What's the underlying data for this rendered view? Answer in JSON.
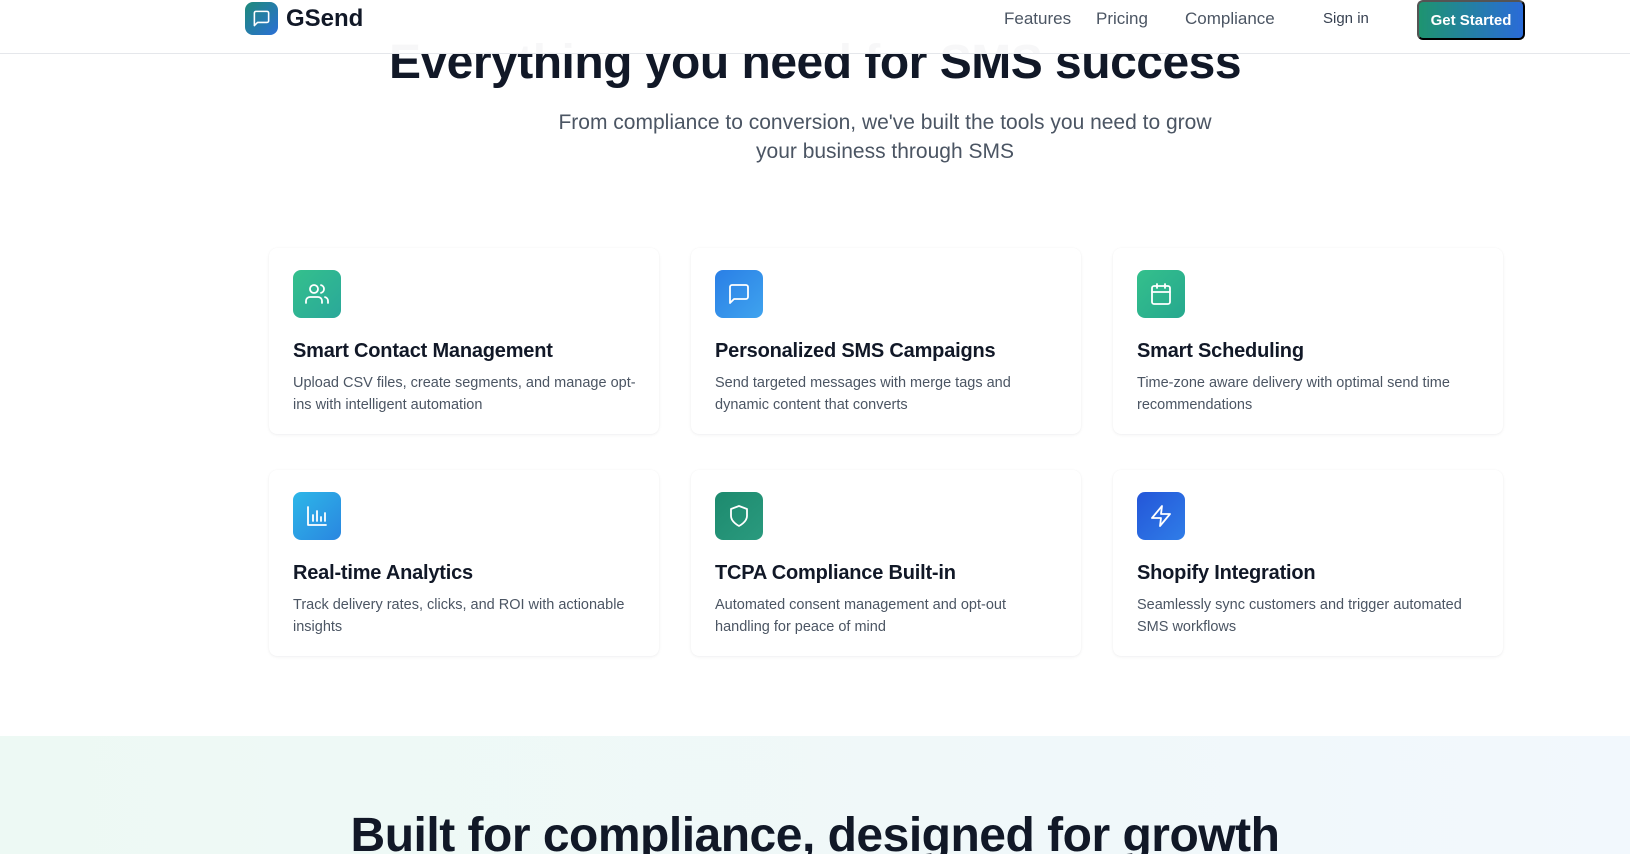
{
  "header": {
    "logo_text": "GSend",
    "nav": [
      "Features",
      "Pricing",
      "Compliance"
    ],
    "sign_in": "Sign in",
    "cta": "Get Started"
  },
  "features_section": {
    "title": "Everything you need for SMS success",
    "subtitle": "From compliance to conversion, we've built the tools you need to grow your business through SMS",
    "cards": [
      {
        "icon": "users-icon",
        "title": "Smart Contact Management",
        "description": "Upload CSV files, create segments, and manage opt-ins with intelligent automation"
      },
      {
        "icon": "message-square-icon",
        "title": "Personalized SMS Campaigns",
        "description": "Send targeted messages with merge tags and dynamic content that converts"
      },
      {
        "icon": "calendar-icon",
        "title": "Smart Scheduling",
        "description": "Time-zone aware delivery with optimal send time recommendations"
      },
      {
        "icon": "bar-chart-icon",
        "title": "Real-time Analytics",
        "description": "Track delivery rates, clicks, and ROI with actionable insights"
      },
      {
        "icon": "shield-icon",
        "title": "TCPA Compliance Built-in",
        "description": "Automated consent management and opt-out handling for peace of mind"
      },
      {
        "icon": "zap-icon",
        "title": "Shopify Integration",
        "description": "Seamlessly sync customers and trigger automated SMS workflows"
      }
    ]
  },
  "compliance_section": {
    "title": "Built for compliance, designed for growth"
  }
}
